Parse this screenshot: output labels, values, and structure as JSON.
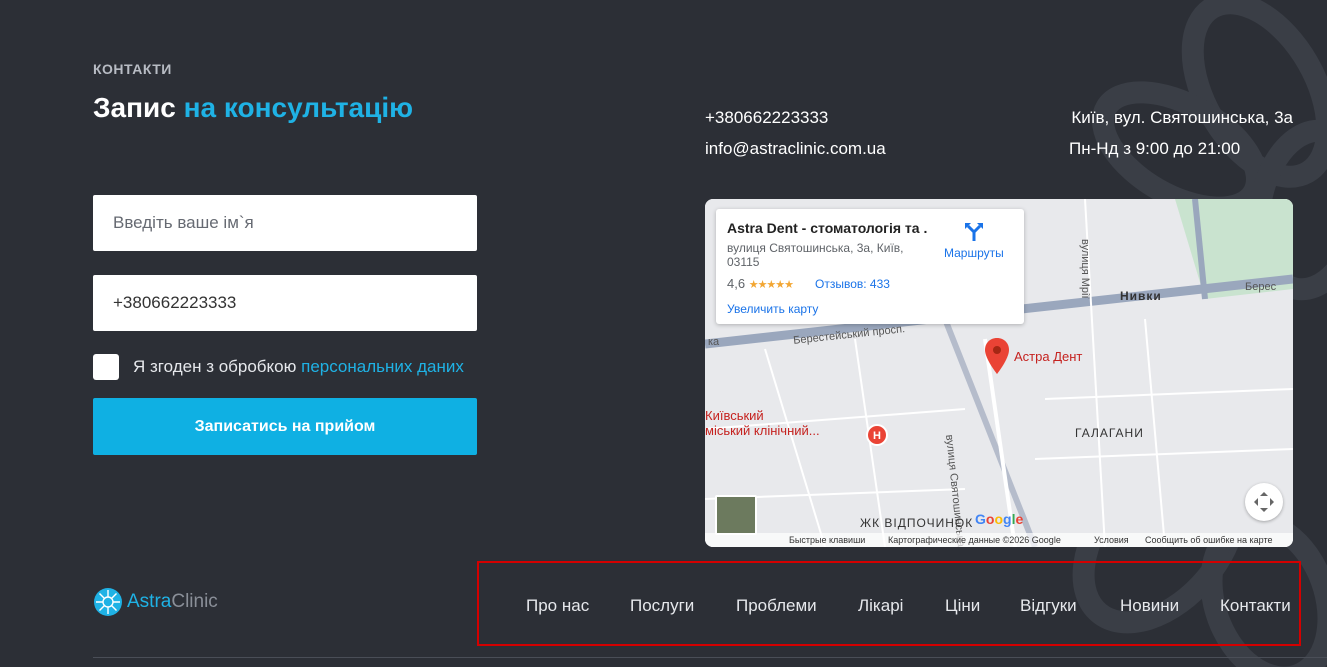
{
  "section_label": "КОНТАКТИ",
  "title": {
    "main": "Запис",
    "accent": "на консультацію"
  },
  "form": {
    "name_placeholder": "Введіть ваше ім`я",
    "phone_value": "+380662223333",
    "consent_text": "Я згоден з обробкою",
    "consent_link": "персональних даних",
    "submit_label": "Записатись на прийом"
  },
  "contacts": {
    "phone": "+380662223333",
    "email": "info@astraclinic.com.ua",
    "address": "Київ, вул. Святошинська, 3а",
    "hours": "Пн-Нд з 9:00 до 21:00"
  },
  "map": {
    "place_name": "Astra Dent - стоматологія та ...",
    "place_address": "вулиця Святошинська, 3а, Київ, 03115",
    "rating": "4,6",
    "stars": "★★★★★",
    "reviews": "Отзывов: 433",
    "enlarge": "Увеличить карту",
    "routes": "Маршруты",
    "pin_label": "Астра Дент",
    "hospital_label_1": "Київський",
    "hospital_label_2": "міський клінічний...",
    "district_1": "ГАЛАГАНИ",
    "district_2": "ЖК ВІДПОЧИНОК",
    "district_3": "Нивки",
    "street_1": "Берестейський просп.",
    "street_2": "вулиця Святошинська",
    "street_3": "вулиця Мрії",
    "street_4": "Берес",
    "google": "Google",
    "footer_shortcuts": "Быстрые клавиши",
    "footer_data": "Картографические данные ©2026 Google",
    "footer_terms": "Условия",
    "footer_report": "Сообщить об ошибке на карте"
  },
  "logo": {
    "part1": "Astra",
    "part2": "Clinic"
  },
  "nav": [
    "Про нас",
    "Послуги",
    "Проблеми",
    "Лікарі",
    "Ціни",
    "Відгуки",
    "Новини",
    "Контакти"
  ],
  "colors": {
    "background": "#2c2f36",
    "accent": "#1fb2e5",
    "button": "#0fb0e3",
    "highlight_border": "#d40000"
  }
}
